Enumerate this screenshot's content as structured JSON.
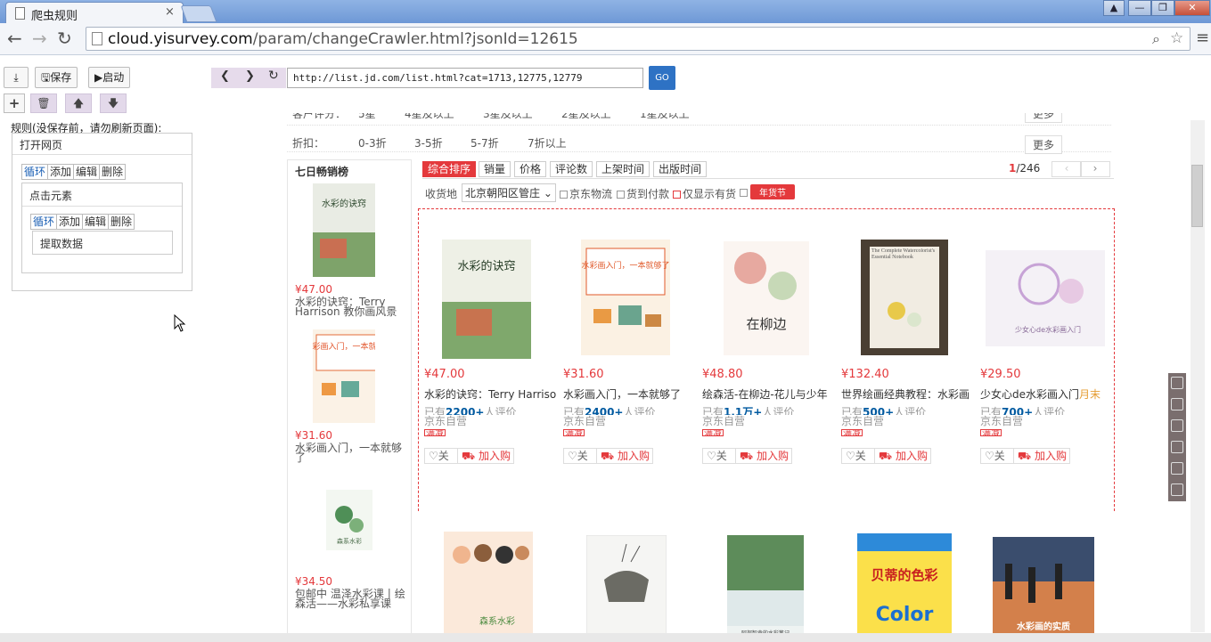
{
  "window": {
    "tab_title": "爬虫规则",
    "close": "×",
    "controls": [
      "▲",
      "—",
      "❐",
      "✕"
    ]
  },
  "address": {
    "host": "cloud.yisurvey.com",
    "path": "/param/changeCrawler.html?jsonId=12615"
  },
  "left_panel": {
    "save_label": "保存",
    "start_label": "启动",
    "rules_label": "规则(没保存前，请勿刷新页面):",
    "open_page": "打开网页",
    "click_element": "点击元素",
    "extract_data": "提取数据",
    "actions": [
      "循环",
      "添加",
      "编辑",
      "删除"
    ]
  },
  "inner_browser": {
    "url": "http://list.jd.com/list.html?cat=1713,12775,12779",
    "go": "GO"
  },
  "jd": {
    "filter_row_1": {
      "label": "客户评分：",
      "options": [
        "5星",
        "4星及以上",
        "3星及以上",
        "2星及以上",
        "1星及以上"
      ],
      "more": "更多"
    },
    "filter_row_2": {
      "label": "折扣：",
      "options": [
        "0-3折",
        "3-5折",
        "5-7折",
        "7折以上"
      ],
      "more": "更多"
    },
    "sidebar": {
      "title": "七日畅销榜",
      "items": [
        {
          "price": "¥47.00",
          "name": "水彩的诀窍：Terry Harrison 教你画风景"
        },
        {
          "price": "¥31.60",
          "name": "水彩画入门，一本就够了"
        },
        {
          "price": "¥34.50",
          "name": "包邮中 温泽水彩课丨绘森活——水彩私享课"
        }
      ]
    },
    "sort": {
      "tabs": [
        "综合排序",
        "销量",
        "价格",
        "评论数",
        "上架时间",
        "出版时间"
      ],
      "page_current": "1",
      "page_total": "/246"
    },
    "filter2": {
      "label": "收货地",
      "location": "北京朝阳区管庄",
      "jd_logistics": "京东物流",
      "cod": "货到付款",
      "instock": "仅显示有货",
      "badge": "年货节"
    },
    "products": [
      {
        "price": "¥47.00",
        "name": "水彩的诀窍：Terry Harrison",
        "reviews_pre": "已有",
        "reviews": "2200+",
        "reviews_post": "人评价",
        "seller": "京东自营",
        "tag": "满减",
        "follow": "关",
        "cart": "加入购"
      },
      {
        "price": "¥31.60",
        "name": "水彩画入门，一本就够了",
        "reviews_pre": "已有",
        "reviews": "2400+",
        "reviews_post": "人评价",
        "seller": "京东自营",
        "tag": "满减",
        "follow": "关",
        "cart": "加入购"
      },
      {
        "price": "¥48.80",
        "name": "绘森活-在柳边-花儿与少年",
        "reviews_pre": "已有",
        "reviews": "1.1万+",
        "reviews_post": "人评价",
        "seller": "京东自营",
        "tag": "满减",
        "follow": "关",
        "cart": "加入购"
      },
      {
        "price": "¥132.40",
        "name": "世界绘画经典教程：水彩画",
        "reviews_pre": "已有",
        "reviews": "500+",
        "reviews_post": "人评价",
        "seller": "京东自营",
        "tag": "满减",
        "follow": "关",
        "cart": "加入购"
      },
      {
        "price": "¥29.50",
        "name": "少女心de水彩画入门",
        "name_extra": "月末",
        "reviews_pre": "已有",
        "reviews": "700+",
        "reviews_post": "人评价",
        "seller": "京东自营",
        "tag": "满减",
        "follow": "关",
        "cart": "加入购"
      }
    ],
    "book_covers": {
      "b1": "水彩的诀窍",
      "b2": "水彩画入门，一本就够了",
      "b3": "在柳边",
      "b4": "The Complete Watercolorist's Essential Notebook",
      "b5": "少女心de水彩画入门",
      "b6": "森系水彩",
      "b7": "阿部智幸的水彩笔记",
      "b8": "贝蒂的色彩",
      "b8b": "Color",
      "b9": "水彩画的实质"
    }
  },
  "colors": {
    "accent": "#e4393c",
    "link": "#005aa0",
    "go": "#2e72c4"
  }
}
